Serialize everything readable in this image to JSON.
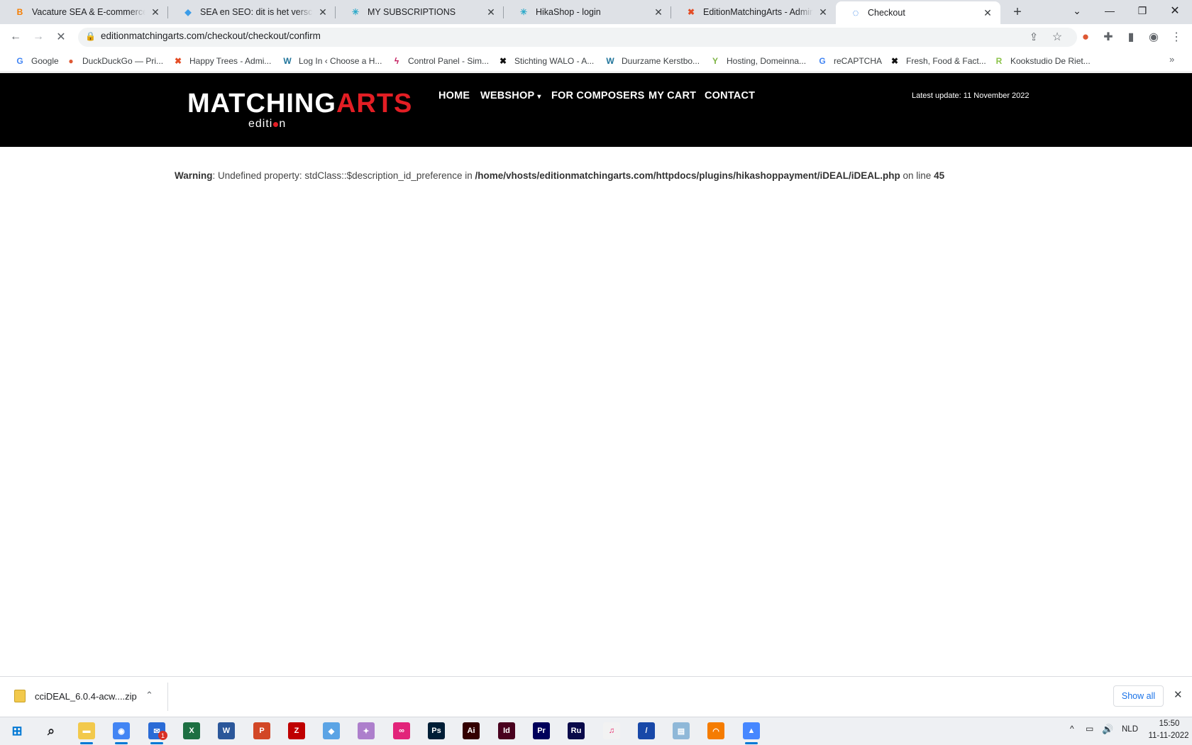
{
  "browser": {
    "tabs": [
      {
        "title": "Vacature SEA & E-commerce Me",
        "icon": "blogger-icon",
        "color": "#f57d00",
        "glyph": "B"
      },
      {
        "title": "SEA en SEO: dit is het verschil (e",
        "icon": "diamond-icon",
        "color": "#3b9ce8",
        "glyph": "◆"
      },
      {
        "title": "MY SUBSCRIPTIONS",
        "icon": "asterisk-icon",
        "color": "#2aa9c9",
        "glyph": "✳"
      },
      {
        "title": "HikaShop - login",
        "icon": "asterisk-icon",
        "color": "#2aa9c9",
        "glyph": "✳"
      },
      {
        "title": "EditionMatchingArts - Administ",
        "icon": "joomla-icon",
        "color": "#e44d26",
        "glyph": "✖"
      },
      {
        "title": "Checkout",
        "icon": "loading-icon",
        "color": "#1a73e8",
        "glyph": "◌"
      }
    ],
    "new_tab_label": "+",
    "url": "editionmatchingarts.com/checkout/checkout/confirm",
    "bookmarks": [
      {
        "label": "Google",
        "icon": "google-icon",
        "color": "#4285f4",
        "glyph": "G"
      },
      {
        "label": "DuckDuckGo — Pri...",
        "icon": "duckduckgo-icon",
        "color": "#de5833",
        "glyph": "●"
      },
      {
        "label": "Happy Trees - Admi...",
        "icon": "joomla-icon",
        "color": "#e44d26",
        "glyph": "✖"
      },
      {
        "label": "Log In ‹ Choose a H...",
        "icon": "wordpress-icon",
        "color": "#21759b",
        "glyph": "W"
      },
      {
        "label": "Control Panel - Sim...",
        "icon": "bolt-icon",
        "color": "#c2185b",
        "glyph": "ϟ"
      },
      {
        "label": "Stichting WALO - A...",
        "icon": "joomla-icon",
        "color": "#111111",
        "glyph": "✖"
      },
      {
        "label": "Duurzame Kerstbo...",
        "icon": "wordpress-icon",
        "color": "#21759b",
        "glyph": "W"
      },
      {
        "label": "Hosting, Domeinna...",
        "icon": "leaf-icon",
        "color": "#7cb342",
        "glyph": "Y"
      },
      {
        "label": "reCAPTCHA",
        "icon": "google-icon",
        "color": "#4285f4",
        "glyph": "G"
      },
      {
        "label": "Fresh, Food & Fact...",
        "icon": "joomla-icon",
        "color": "#111111",
        "glyph": "✖"
      },
      {
        "label": "Kookstudio De Riet...",
        "icon": "r-icon",
        "color": "#8bc34a",
        "glyph": "R"
      }
    ]
  },
  "site": {
    "logo": {
      "main_left": "MATCH",
      "main_right": "ARTS",
      "ing": "ING",
      "sub": "editi",
      "sub_end": "n"
    },
    "nav": [
      "HOME",
      "WEBSHOP",
      "FOR COMPOSERS",
      "MY CART",
      "CONTACT"
    ],
    "latest_update": "Latest update: 11 November 2022",
    "accent_color": "#e31e24"
  },
  "warning": {
    "label": "Warning",
    "message": ": Undefined property: stdClass::$description_id_preference in ",
    "path": "/home/vhosts/editionmatchingarts.com/httpdocs/plugins/hikashoppayment/iDEAL/iDEAL.php",
    "line_text": " on line ",
    "line_number": "45"
  },
  "downloads": {
    "file": "cciDEAL_6.0.4-acw....zip",
    "show_all": "Show all"
  },
  "taskbar": {
    "language": "NLD",
    "time": "15:50",
    "date": "11-11-2022",
    "mail_badge": "1",
    "apps": [
      {
        "name": "file-explorer-icon",
        "bg": "#f2c94c",
        "glyph": "▬"
      },
      {
        "name": "chrome-icon",
        "bg": "#4285f4",
        "glyph": "◉"
      },
      {
        "name": "thunderbird-icon",
        "bg": "#2a6bd6",
        "glyph": "✉"
      },
      {
        "name": "excel-icon",
        "bg": "#1d6f42",
        "glyph": "X"
      },
      {
        "name": "word-icon",
        "bg": "#2b579a",
        "glyph": "W"
      },
      {
        "name": "powerpoint-icon",
        "bg": "#d24726",
        "glyph": "P"
      },
      {
        "name": "filezilla-icon",
        "bg": "#bf0000",
        "glyph": "Z"
      },
      {
        "name": "sourcetree-icon",
        "bg": "#5ba4e5",
        "glyph": "◆"
      },
      {
        "name": "inkscape-icon",
        "bg": "#ad7fcc",
        "glyph": "✦"
      },
      {
        "name": "creative-cloud-icon",
        "bg": "#e2247a",
        "glyph": "∞"
      },
      {
        "name": "photoshop-icon",
        "bg": "#001e36",
        "glyph": "Ps"
      },
      {
        "name": "illustrator-icon",
        "bg": "#330000",
        "glyph": "Ai"
      },
      {
        "name": "indesign-icon",
        "bg": "#49021f",
        "glyph": "Id"
      },
      {
        "name": "premiere-icon",
        "bg": "#00005b",
        "glyph": "Pr"
      },
      {
        "name": "rush-icon",
        "bg": "#0a0a4a",
        "glyph": "Ru"
      },
      {
        "name": "itunes-icon",
        "bg": "#f2f2f2",
        "glyph": "♫"
      },
      {
        "name": "pen-app-icon",
        "bg": "#1848a8",
        "glyph": "/"
      },
      {
        "name": "notepad-icon",
        "bg": "#8fb8d8",
        "glyph": "▤"
      },
      {
        "name": "headphones-app-icon",
        "bg": "#f57c00",
        "glyph": "◠"
      },
      {
        "name": "vpn-icon",
        "bg": "#4687ff",
        "glyph": "▲"
      }
    ]
  }
}
